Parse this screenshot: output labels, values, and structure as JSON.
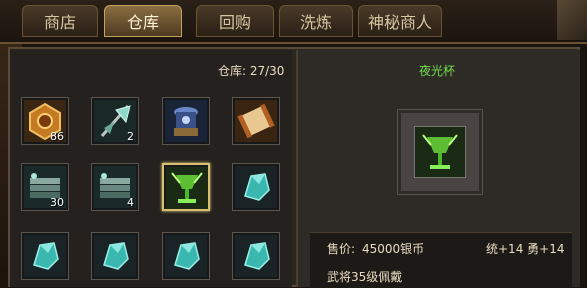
{
  "tabs": [
    {
      "label": "商店"
    },
    {
      "label": "仓库"
    },
    {
      "label": "回购"
    },
    {
      "label": "洗炼"
    },
    {
      "label": "神秘商人"
    }
  ],
  "warehouse": {
    "capacity": "仓库: 27/30"
  },
  "slots": [
    {
      "icon": "treasure-chest-icon",
      "count": "86"
    },
    {
      "icon": "axe-weapon-icon",
      "count": "2"
    },
    {
      "icon": "blue-vessel-icon",
      "count": ""
    },
    {
      "icon": "scroll-icon",
      "count": ""
    },
    {
      "icon": "armor-plate-icon",
      "count": "30"
    },
    {
      "icon": "armor-plate-icon",
      "count": "4"
    },
    {
      "icon": "night-glow-cup-icon",
      "count": ""
    },
    {
      "icon": "cyan-crystal-icon",
      "count": ""
    },
    {
      "icon": "cyan-crystal-icon",
      "count": ""
    },
    {
      "icon": "cyan-crystal-icon",
      "count": ""
    },
    {
      "icon": "cyan-crystal-icon",
      "count": ""
    },
    {
      "icon": "cyan-crystal-icon",
      "count": ""
    }
  ],
  "detail": {
    "name": "夜光杯",
    "price_label": "售价:",
    "price": "45000银币",
    "stats": "统+14 勇+14",
    "requirement": "武将35级佩戴"
  }
}
